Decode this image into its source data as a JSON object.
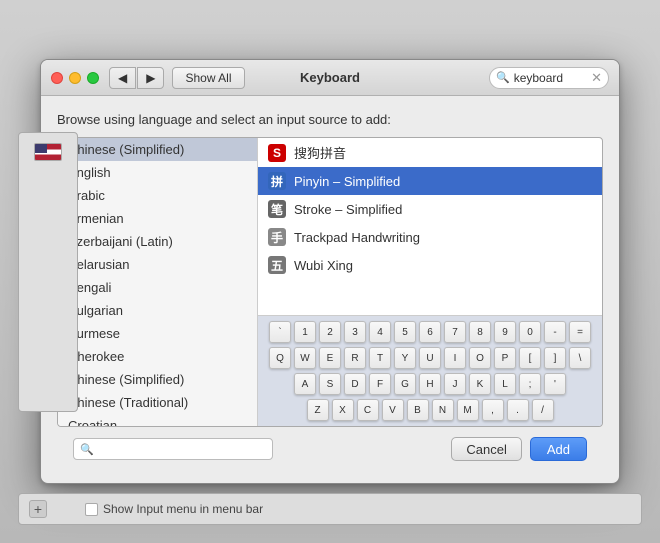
{
  "window": {
    "title": "Keyboard"
  },
  "toolbar": {
    "show_all_label": "Show All",
    "search_placeholder": "keyboard",
    "search_value": "keyboard"
  },
  "dialog": {
    "browse_label": "Browse using language and select an input source to add:"
  },
  "languages": [
    {
      "id": "chinese-simplified",
      "label": "Chinese (Simplified)",
      "selected": true
    },
    {
      "id": "english",
      "label": "English",
      "selected": false
    },
    {
      "id": "arabic",
      "label": "Arabic",
      "selected": false
    },
    {
      "id": "armenian",
      "label": "Armenian",
      "selected": false
    },
    {
      "id": "azerbaijani",
      "label": "Azerbaijani (Latin)",
      "selected": false
    },
    {
      "id": "belarusian",
      "label": "Belarusian",
      "selected": false
    },
    {
      "id": "bengali",
      "label": "Bengali",
      "selected": false
    },
    {
      "id": "bulgarian",
      "label": "Bulgarian",
      "selected": false
    },
    {
      "id": "burmese",
      "label": "Burmese",
      "selected": false
    },
    {
      "id": "cherokee",
      "label": "Cherokee",
      "selected": false
    },
    {
      "id": "chinese-simplified-2",
      "label": "Chinese (Simplified)",
      "selected": false
    },
    {
      "id": "chinese-traditional",
      "label": "Chinese (Traditional)",
      "selected": false
    },
    {
      "id": "croatian",
      "label": "Croatian",
      "selected": false
    }
  ],
  "input_sources": [
    {
      "id": "sougou",
      "label": "搜狗拼音",
      "icon_type": "sougou",
      "icon_text": "S",
      "selected": false
    },
    {
      "id": "pinyin",
      "label": "Pinyin – Simplified",
      "icon_type": "pinyin",
      "icon_text": "拼",
      "selected": true
    },
    {
      "id": "stroke",
      "label": "Stroke – Simplified",
      "icon_type": "stroke",
      "icon_text": "笔",
      "selected": false
    },
    {
      "id": "trackpad",
      "label": "Trackpad Handwriting",
      "icon_type": "trackpad",
      "icon_text": "手",
      "selected": false
    },
    {
      "id": "wubi",
      "label": "Wubi Xing",
      "icon_type": "wubi",
      "icon_text": "五",
      "selected": false
    }
  ],
  "keyboard_rows": [
    {
      "keys": [
        "`",
        "1",
        "2",
        "3",
        "4",
        "5",
        "6",
        "7",
        "8",
        "9",
        "0",
        "-",
        "="
      ]
    },
    {
      "keys": [
        "Q",
        "W",
        "E",
        "R",
        "T",
        "Y",
        "U",
        "I",
        "O",
        "P",
        "[",
        "]",
        "\\"
      ]
    },
    {
      "keys": [
        "A",
        "S",
        "D",
        "F",
        "G",
        "H",
        "J",
        "K",
        "L",
        ";",
        "'"
      ]
    },
    {
      "keys": [
        "Z",
        "X",
        "C",
        "V",
        "B",
        "N",
        "M",
        ",",
        ".",
        "/"
      ]
    }
  ],
  "buttons": {
    "cancel_label": "Cancel",
    "add_label": "Add"
  },
  "bottom": {
    "search_placeholder": "",
    "add_icon": "+",
    "checkbox_label": "Show Input menu in menu bar"
  }
}
